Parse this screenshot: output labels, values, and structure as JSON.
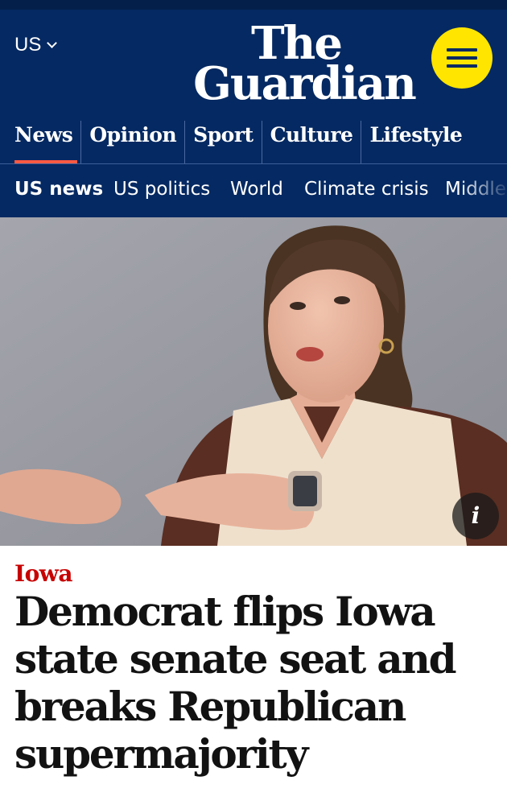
{
  "header": {
    "edition_label": "US",
    "logo_line1": "The",
    "logo_line2": "Guardian",
    "brand_color": "#052962",
    "menu_button_color": "#ffe500",
    "menu_icon": "hamburger-icon"
  },
  "pillars": [
    {
      "label": "News",
      "active": true
    },
    {
      "label": "Opinion",
      "active": false
    },
    {
      "label": "Sport",
      "active": false
    },
    {
      "label": "Culture",
      "active": false
    },
    {
      "label": "Lifestyle",
      "active": false
    }
  ],
  "pillar_active_color": "#ff5943",
  "subnav": [
    {
      "label": "US news",
      "bold": true
    },
    {
      "label": "US politics",
      "bold": false
    },
    {
      "label": "World",
      "bold": false
    },
    {
      "label": "Climate crisis",
      "bold": false
    },
    {
      "label": "Middle",
      "bold": false
    }
  ],
  "hero": {
    "info_button_label": "i"
  },
  "article": {
    "kicker": "Iowa",
    "kicker_color": "#c70000",
    "headline": "Democrat flips Iowa state senate seat and breaks Republican supermajority"
  }
}
